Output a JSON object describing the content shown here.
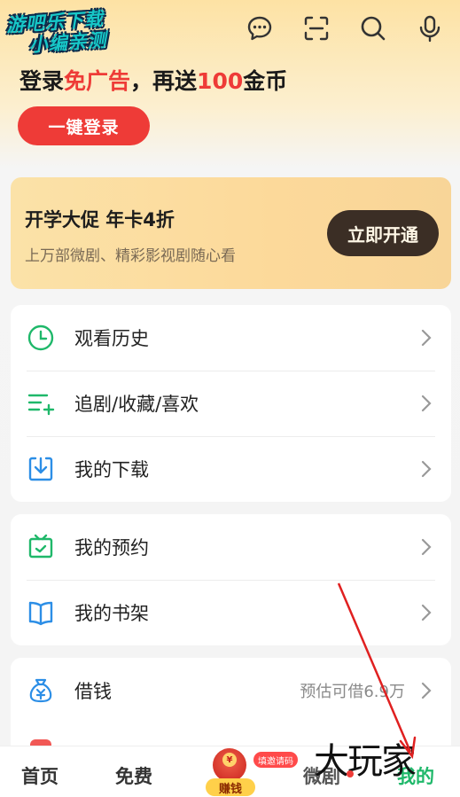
{
  "watermark_top": {
    "line1": "游吧乐下载",
    "line2": "小编亲测"
  },
  "header_icons": [
    "message-icon",
    "scan-icon",
    "search-icon",
    "microphone-icon"
  ],
  "login": {
    "title_part1": "登录",
    "title_highlight1": "免广告",
    "title_part2": "，再送",
    "title_highlight2": "100",
    "title_part3": "金币",
    "button": "一键登录"
  },
  "promo": {
    "title": "开学大促 年卡4折",
    "subtitle": "上万部微剧、精彩影视剧随心看",
    "button": "立即开通"
  },
  "menu_group1": [
    {
      "label": "观看历史",
      "icon": "clock-icon"
    },
    {
      "label": "追剧/收藏/喜欢",
      "icon": "list-add-icon"
    },
    {
      "label": "我的下载",
      "icon": "download-icon"
    }
  ],
  "menu_group2": [
    {
      "label": "我的预约",
      "icon": "tv-reserve-icon"
    },
    {
      "label": "我的书架",
      "icon": "book-icon"
    }
  ],
  "menu_group3": [
    {
      "label": "借钱",
      "icon": "money-bag-icon",
      "extra": "预估可借6.9万"
    }
  ],
  "tabbar": {
    "home": "首页",
    "free": "免费",
    "earn": "赚钱",
    "invite_badge": "填邀请码",
    "microdrama": "微剧",
    "mine": "我的"
  },
  "watermark_bottom": "大玩家",
  "colors": {
    "accent_red": "#ee3b37",
    "green": "#1fb86a",
    "blue": "#2c8ee6",
    "promo_btn": "#3b2e25"
  }
}
